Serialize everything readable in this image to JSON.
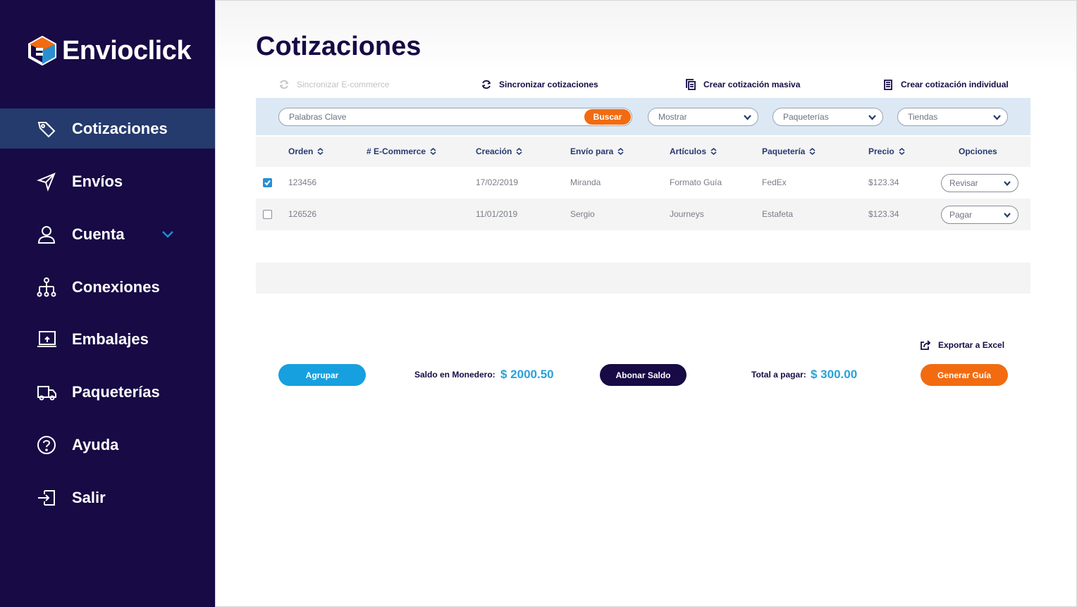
{
  "brand": {
    "name": "Envioclick",
    "colors": {
      "navy": "#170a45",
      "active": "#253a6d",
      "orange": "#f26b10",
      "blue": "#16a0df"
    }
  },
  "sidebar": {
    "items": [
      {
        "label": "Cotizaciones",
        "icon": "tag-icon",
        "active": true
      },
      {
        "label": "Envíos",
        "icon": "send-icon"
      },
      {
        "label": "Cuenta",
        "icon": "user-icon",
        "expandable": true
      },
      {
        "label": "Conexiones",
        "icon": "network-icon"
      },
      {
        "label": "Embalajes",
        "icon": "box-icon"
      },
      {
        "label": "Paqueterías",
        "icon": "truck-icon"
      },
      {
        "label": "Ayuda",
        "icon": "help-icon"
      },
      {
        "label": "Salir",
        "icon": "logout-icon"
      }
    ]
  },
  "main": {
    "title": "Cotizaciones",
    "actions": {
      "sync_ecommerce": "Sincronizar E-commerce",
      "sync_quotes": "Sincronizar cotizaciones",
      "bulk_quote": "Crear cotización masiva",
      "single_quote": "Crear cotización individual"
    },
    "filters": {
      "search_placeholder": "Palabras Clave",
      "search_button": "Buscar",
      "show": "Mostrar",
      "carriers": "Paqueterías",
      "stores": "Tiendas"
    },
    "table": {
      "headers": [
        "Orden",
        "# E-Commerce",
        "Creación",
        "Envío para",
        "Artículos",
        "Paquetería",
        "Precio",
        "Opciones"
      ],
      "rows": [
        {
          "checked": true,
          "order": "123456",
          "ecommerce": "",
          "created": "17/02/2019",
          "recipient": "Miranda",
          "items": "Formato Guía",
          "carrier": "FedEx",
          "price": "$123.34",
          "option": "Revisar"
        },
        {
          "checked": false,
          "order": "126526",
          "ecommerce": "",
          "created": "11/01/2019",
          "recipient": "Sergio",
          "items": "Journeys",
          "carrier": "Estafeta",
          "price": "$123.34",
          "option": "Pagar"
        }
      ]
    },
    "export_label": "Exportar a Excel",
    "footer": {
      "group_button": "Agrupar",
      "wallet_label": "Saldo en Monedero:",
      "wallet_amount": "$ 2000.50",
      "topup_button": "Abonar Saldo",
      "total_label": "Total a pagar:",
      "total_amount": "$ 300.00",
      "generate_button": "Generar Guía"
    }
  }
}
